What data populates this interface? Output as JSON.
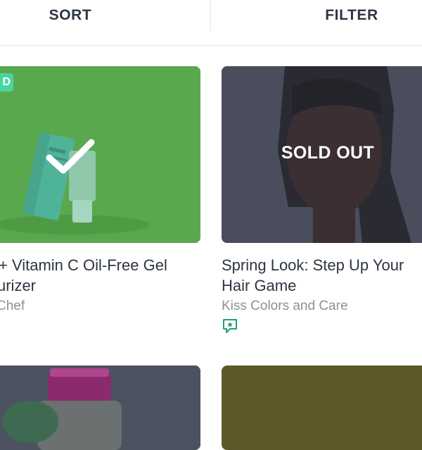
{
  "header": {
    "sort_label": "SORT",
    "filter_label": "FILTER"
  },
  "products": [
    {
      "title_line1": " + Vitamin C Oil-Free Gel",
      "title_line2": "urizer",
      "brand": "Chef",
      "badge": "D",
      "selected": true
    },
    {
      "title_line1": "Spring Look: Step Up Your",
      "title_line2": "Hair Game",
      "brand": "Kiss Colors and Care",
      "overlay": "SOLD OUT",
      "icon": "chat-star-icon"
    }
  ],
  "colors": {
    "accent": "#47d6a0",
    "selected_overlay": "#5aa84d",
    "dark_overlay": "#4a4d5c",
    "text": "#2c3542",
    "muted": "#8c9199"
  }
}
